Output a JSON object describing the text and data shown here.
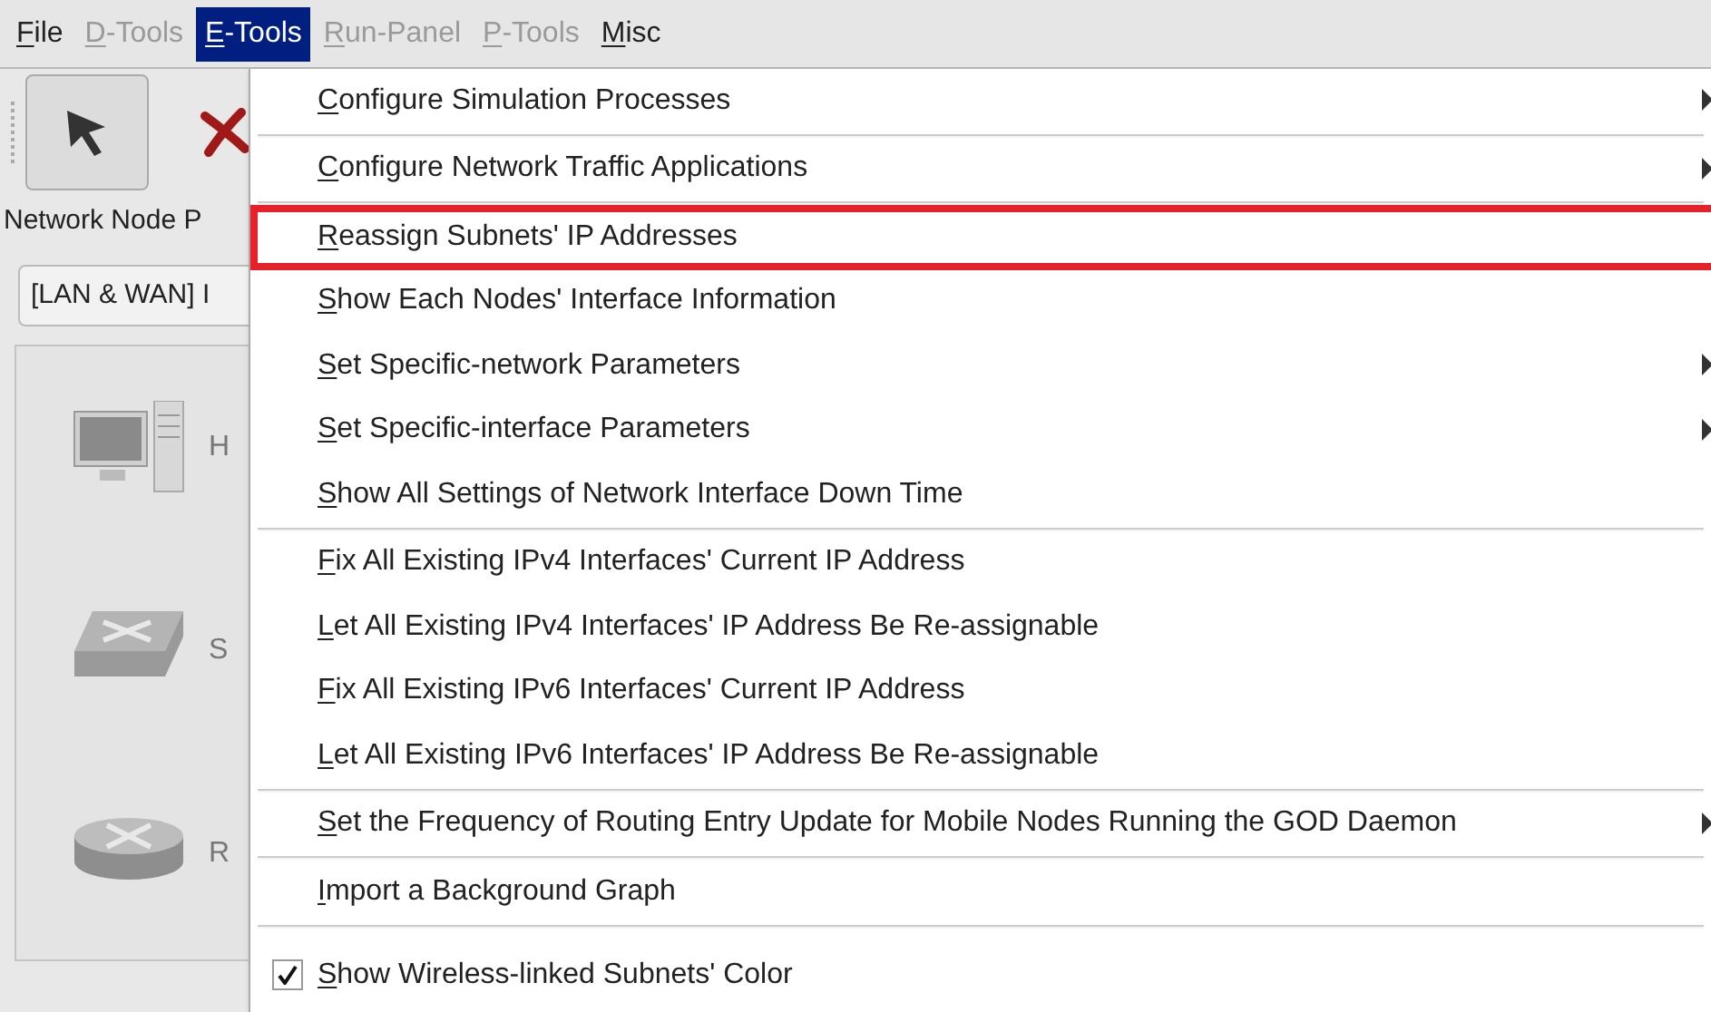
{
  "menu_bar": [
    {
      "label": "File",
      "disabled": false,
      "selected": false
    },
    {
      "label": "D-Tools",
      "disabled": true,
      "selected": false
    },
    {
      "label": "E-Tools",
      "disabled": false,
      "selected": true
    },
    {
      "label": "Run-Panel",
      "disabled": true,
      "selected": false
    },
    {
      "label": "P-Tools",
      "disabled": true,
      "selected": false
    },
    {
      "label": "Misc",
      "disabled": false,
      "selected": false
    }
  ],
  "toolbar": [
    {
      "kind": "select",
      "selected": true
    },
    {
      "kind": "delete",
      "selected": false
    }
  ],
  "palette": {
    "title": "Network Node P",
    "category": "[LAN & WAN] I",
    "nodes": [
      {
        "kind": "host",
        "label": "H"
      },
      {
        "kind": "switch",
        "label": "S"
      },
      {
        "kind": "router",
        "label": "R"
      }
    ]
  },
  "dropdown_menu": {
    "groups": [
      [
        {
          "label": "Configure Simulation Processes",
          "submenu": true,
          "annotated": false
        }
      ],
      [
        {
          "label": "Configure Network Traffic Applications",
          "submenu": true,
          "annotated": false
        }
      ],
      [
        {
          "label": "Reassign Subnets' IP Addresses",
          "submenu": false,
          "annotated": true
        },
        {
          "label": "Show Each Nodes' Interface Information",
          "submenu": false,
          "annotated": false
        },
        {
          "label": "Set Specific-network Parameters",
          "submenu": true,
          "annotated": false
        },
        {
          "label": "Set Specific-interface Parameters",
          "submenu": true,
          "annotated": false
        },
        {
          "label": "Show All Settings of Network Interface Down Time",
          "submenu": false,
          "annotated": false
        }
      ],
      [
        {
          "label": "Fix All Existing IPv4 Interfaces' Current IP Address",
          "submenu": false,
          "annotated": false
        },
        {
          "label": "Let All Existing IPv4 Interfaces' IP Address Be Re-assignable",
          "submenu": false,
          "annotated": false
        },
        {
          "label": "Fix All Existing IPv6 Interfaces' Current IP Address",
          "submenu": false,
          "annotated": false
        },
        {
          "label": "Let All Existing IPv6 Interfaces' IP Address Be Re-assignable",
          "submenu": false,
          "annotated": false
        }
      ],
      [
        {
          "label": "Set the Frequency of Routing Entry Update for Mobile Nodes Running the GOD Daemon",
          "submenu": true,
          "annotated": false
        }
      ],
      [
        {
          "label": "Import a Background Graph",
          "submenu": false,
          "annotated": false
        }
      ],
      [
        {
          "label": "Show Wireless-linked Subnets' Color",
          "kind": "check",
          "checked": true,
          "submenu": false,
          "annotated": false
        }
      ]
    ]
  }
}
